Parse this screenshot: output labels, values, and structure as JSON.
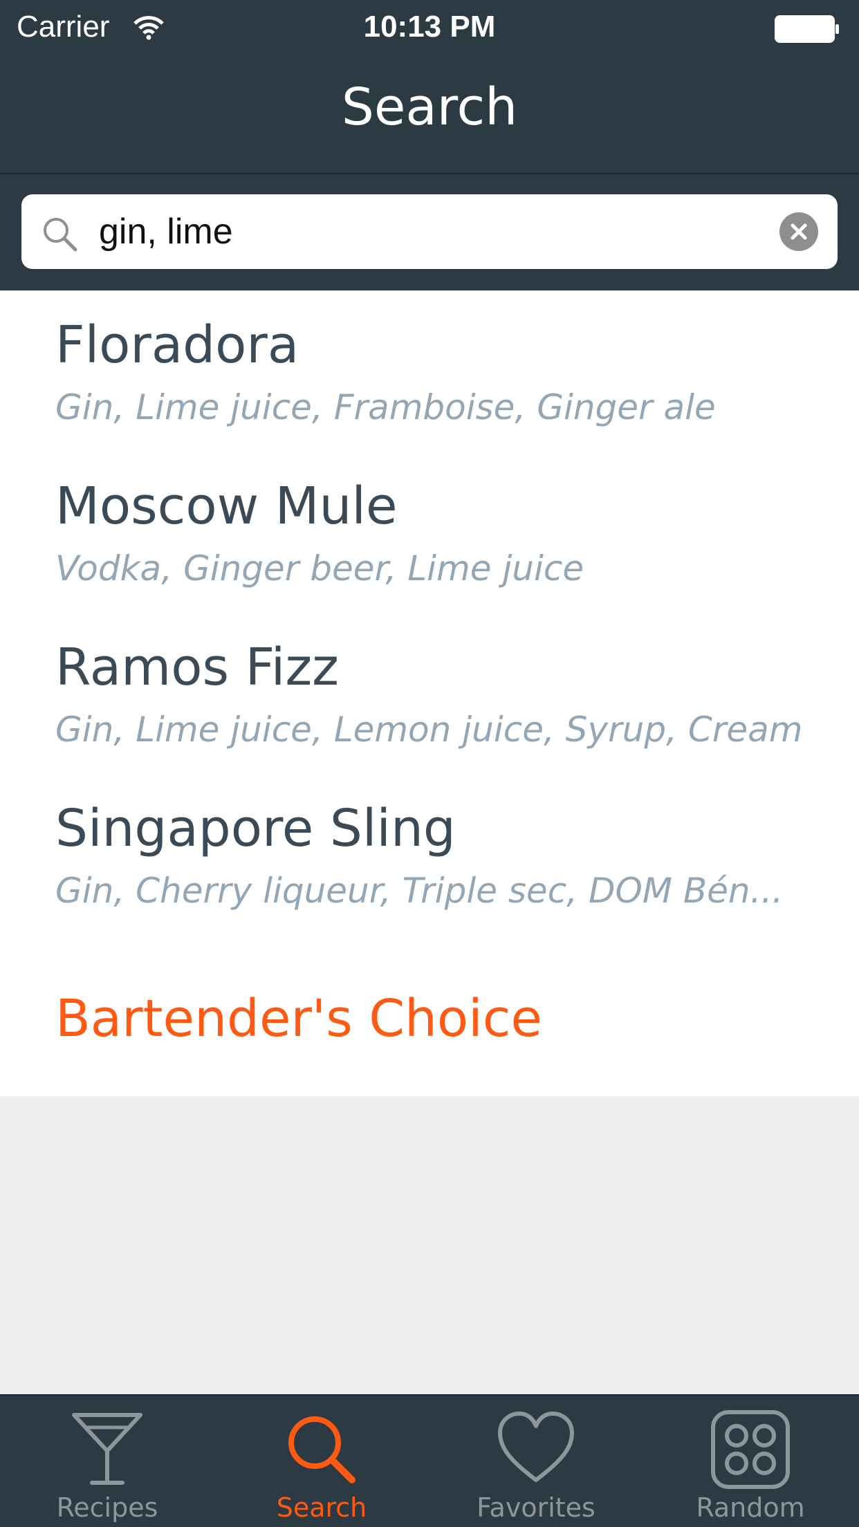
{
  "status_bar": {
    "carrier": "Carrier",
    "time": "10:13 PM"
  },
  "navbar": {
    "title": "Search"
  },
  "search": {
    "value": "gin, lime",
    "placeholder": ""
  },
  "results": [
    {
      "title": "Floradora",
      "ingredients": "Gin, Lime juice, Framboise, Ginger ale"
    },
    {
      "title": "Moscow Mule",
      "ingredients": "Vodka, Ginger beer, Lime juice"
    },
    {
      "title": "Ramos Fizz",
      "ingredients": "Gin, Lime juice, Lemon juice, Syrup, Cream"
    },
    {
      "title": "Singapore Sling",
      "ingredients": "Gin, Cherry liqueur, Triple sec, DOM Bén..."
    }
  ],
  "bartender_link": "Bartender's Choice",
  "tabs": [
    {
      "label": "Recipes",
      "icon": "cocktail-glass-icon",
      "active": false
    },
    {
      "label": "Search",
      "icon": "search-icon",
      "active": true
    },
    {
      "label": "Favorites",
      "icon": "heart-icon",
      "active": false
    },
    {
      "label": "Random",
      "icon": "dice-icon",
      "active": false
    }
  ],
  "colors": {
    "bar_background": "#2c3a44",
    "accent": "#ff5a14",
    "title_text": "#3a4a57",
    "subtitle_text": "#93a6b5",
    "tab_inactive": "#8d969c"
  }
}
